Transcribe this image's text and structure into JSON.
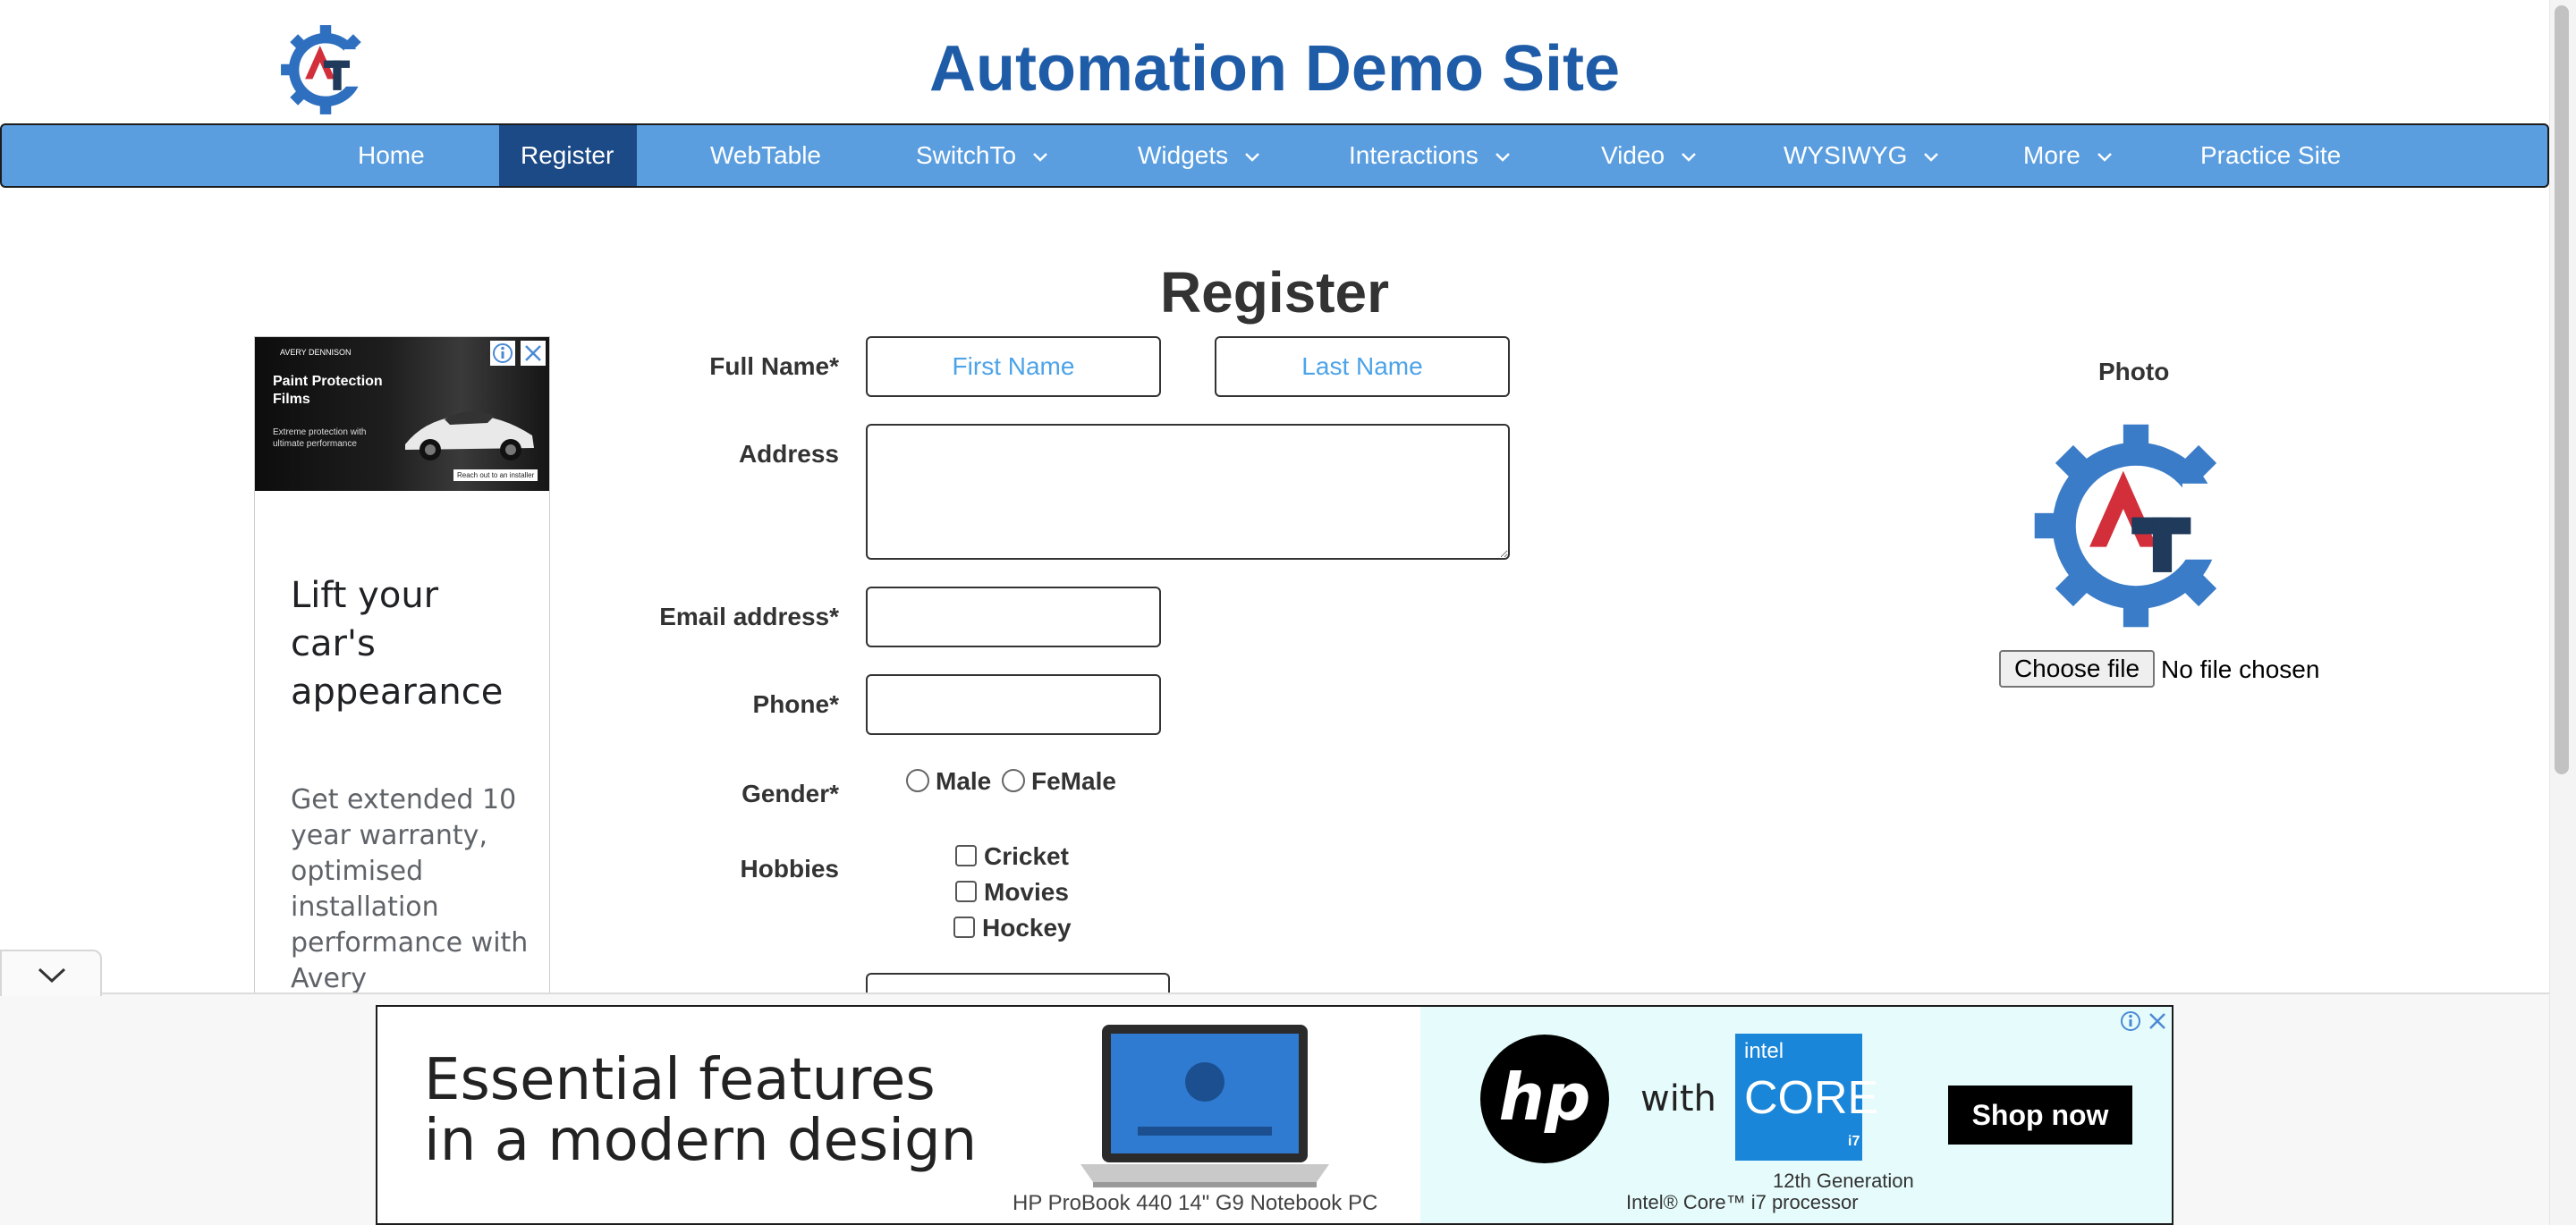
{
  "header": {
    "site_title": "Automation Demo Site"
  },
  "nav": {
    "items": [
      {
        "label": "Home"
      },
      {
        "label": "Register"
      },
      {
        "label": "WebTable"
      },
      {
        "label": "SwitchTo"
      },
      {
        "label": "Widgets"
      },
      {
        "label": "Interactions"
      },
      {
        "label": "Video"
      },
      {
        "label": "WYSIWYG"
      },
      {
        "label": "More"
      },
      {
        "label": "Practice Site"
      }
    ],
    "active": "Register"
  },
  "page": {
    "heading": "Register"
  },
  "form": {
    "full_name_label": "Full Name*",
    "first_name_placeholder": "First Name",
    "last_name_placeholder": "Last Name",
    "address_label": "Address",
    "email_label": "Email address*",
    "phone_label": "Phone*",
    "gender_label": "Gender*",
    "gender_options": [
      "Male",
      "FeMale"
    ],
    "hobbies_label": "Hobbies",
    "hobbies": [
      "Cricket",
      "Movies",
      "Hockey"
    ]
  },
  "photo": {
    "label": "Photo",
    "choose_file_button": "Choose file",
    "file_status": "No file chosen"
  },
  "ad_left": {
    "brand": "AVERY DENNISON",
    "product": "Paint Protection Films",
    "tagline": "Extreme protection with ultimate performance",
    "cta": "Reach out to an installer",
    "headline": "Lift your car's appearance",
    "body": "Get extended 10 year warranty, optimised installation performance with Avery"
  },
  "ad_bottom": {
    "headline_line1": "Essential features",
    "headline_line2": "in a modern design",
    "laptop_caption": "HP ProBook 440 14\" G9 Notebook PC",
    "with_text": "with",
    "intel_line1": "intel",
    "intel_line2": "CORE",
    "intel_line3": "i7",
    "generation": "12th Generation",
    "processor": "Intel® Core™ i7 processor",
    "cta": "Shop now"
  },
  "colors": {
    "title_blue": "#1f5ca8",
    "nav_bg": "#5a9ee0",
    "nav_active": "#1c4a86",
    "placeholder_blue": "#4da3e8",
    "logo_red": "#d22f3a",
    "logo_dark": "#1f3a5a"
  }
}
